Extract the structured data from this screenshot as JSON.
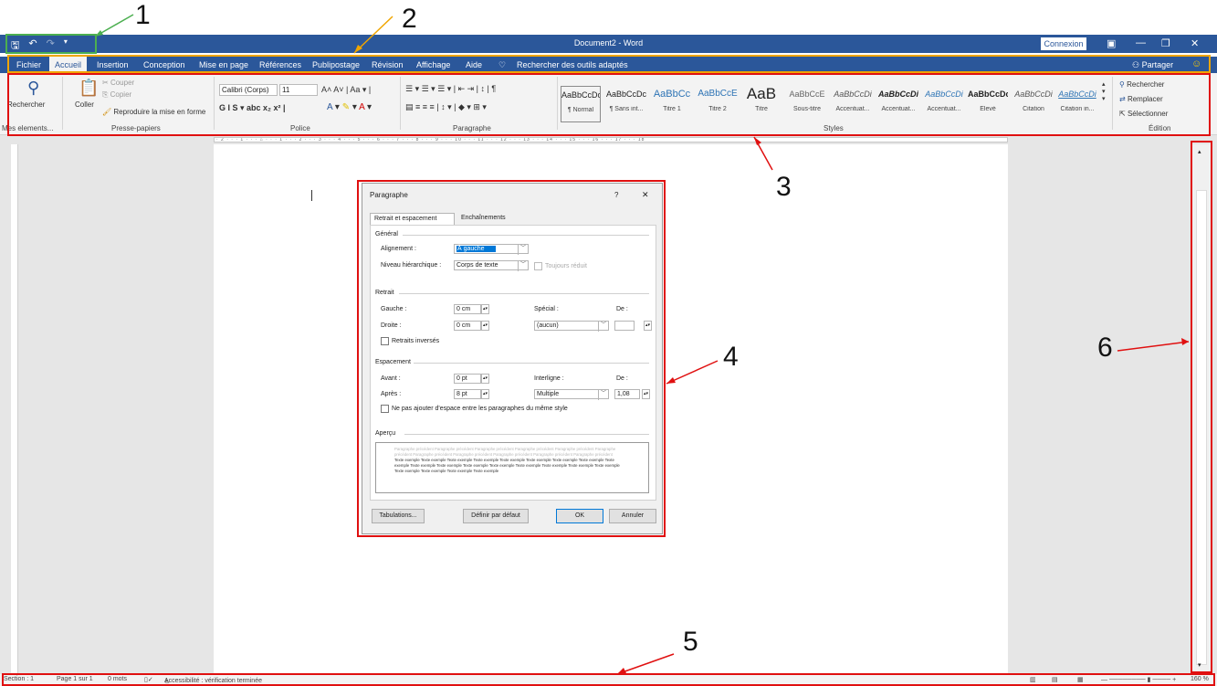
{
  "title_bar": {
    "doc_title": "Document2 - Word",
    "connexion": "Connexion",
    "icons": [
      "save-icon",
      "undo-icon",
      "redo-icon",
      "customize-qat-icon"
    ]
  },
  "tabs": [
    "Fichier",
    "Accueil",
    "Insertion",
    "Conception",
    "Mise en page",
    "Références",
    "Publipostage",
    "Révision",
    "Affichage",
    "Aide"
  ],
  "active_tab": "Accueil",
  "search_tools": "Rechercher des outils adaptés",
  "share": "Partager",
  "ribbon": {
    "mes_elements": {
      "button": "Rechercher",
      "group": "Mes elements..."
    },
    "clipboard": {
      "paste": "Coller",
      "cut": "Couper",
      "copy": "Copier",
      "format_painter": "Reproduire la mise en forme",
      "group": "Presse-papiers"
    },
    "font": {
      "font_name": "Calibri (Corps)",
      "font_size": "11",
      "group": "Police"
    },
    "paragraph": {
      "group": "Paragraphe"
    },
    "styles": {
      "group": "Styles",
      "items": [
        {
          "sample": "AaBbCcDc",
          "name": "¶ Normal"
        },
        {
          "sample": "AaBbCcDc",
          "name": "¶ Sans int..."
        },
        {
          "sample": "AaBbCc",
          "name": "Titre 1"
        },
        {
          "sample": "AaBbCcE",
          "name": "Titre 2"
        },
        {
          "sample": "AaB",
          "name": "Titre"
        },
        {
          "sample": "AaBbCcE",
          "name": "Sous-titre"
        },
        {
          "sample": "AaBbCcDi",
          "name": "Accentuat..."
        },
        {
          "sample": "AaBbCcDi",
          "name": "Accentuat..."
        },
        {
          "sample": "AaBbCcDi",
          "name": "Accentuat..."
        },
        {
          "sample": "AaBbCcDc",
          "name": "Élevé"
        },
        {
          "sample": "AaBbCcDi",
          "name": "Citation"
        },
        {
          "sample": "AaBbCcDi",
          "name": "Citation in..."
        }
      ]
    },
    "editing": {
      "find": "Rechercher",
      "replace": "Remplacer",
      "select": "Sélectionner",
      "group": "Édition"
    }
  },
  "dialog": {
    "title": "Paragraphe",
    "help": "?",
    "close": "✕",
    "tab1": "Retrait et espacement",
    "tab2": "Enchaînements",
    "general": "Général",
    "alignment_label": "Alignement :",
    "alignment_value": "À gauche",
    "level_label": "Niveau hiérarchique :",
    "level_value": "Corps de texte",
    "collapsed": "Toujours réduit",
    "indent": "Retrait",
    "left_label": "Gauche :",
    "left_value": "0 cm",
    "right_label": "Droite :",
    "right_value": "0 cm",
    "special_label": "Spécial :",
    "special_value": "(aucun)",
    "by_label": "De :",
    "mirror": "Retraits inversés",
    "spacing": "Espacement",
    "before_label": "Avant :",
    "before_value": "0 pt",
    "after_label": "Après :",
    "after_value": "8 pt",
    "line_label": "Interligne :",
    "line_value": "Multiple",
    "at_label": "De :",
    "at_value": "1,08",
    "no_space": "Ne pas ajouter d'espace entre les paragraphes du même style",
    "preview": "Aperçu",
    "preview_prev": "Paragraphe précédent Paragraphe précédent Paragraphe précédent Paragraphe précédent Paragraphe précédent Paragraphe précédent Paragraphe précédent Paragraphe précédent Paragraphe précédent Paragraphe précédent Paragraphe précédent",
    "preview_example": "Texte exemple Texte exemple Texte exemple Texte exemple Texte exemple Texte exemple Texte exemple Texte exemple Texte exemple Texte exemple Texte exemple Texte exemple Texte exemple Texte exemple Texte exemple Texte exemple Texte exemple Texte exemple Texte exemple Texte exemple Texte exemple",
    "tabs_button": "Tabulations...",
    "default_button": "Définir par défaut",
    "ok": "OK",
    "cancel": "Annuler"
  },
  "statusbar": {
    "section": "Section : 1",
    "page": "Page 1 sur 1",
    "words": "0 mots",
    "accessibility": "Accessibilité : vérification terminée",
    "zoom": "160 %"
  },
  "annotations": [
    "1",
    "2",
    "3",
    "4",
    "5",
    "6"
  ],
  "colors": {
    "word_blue": "#2b579a",
    "annotation_red": "#e01010",
    "annotation_green": "#4caf50",
    "annotation_orange": "#f0a500"
  }
}
